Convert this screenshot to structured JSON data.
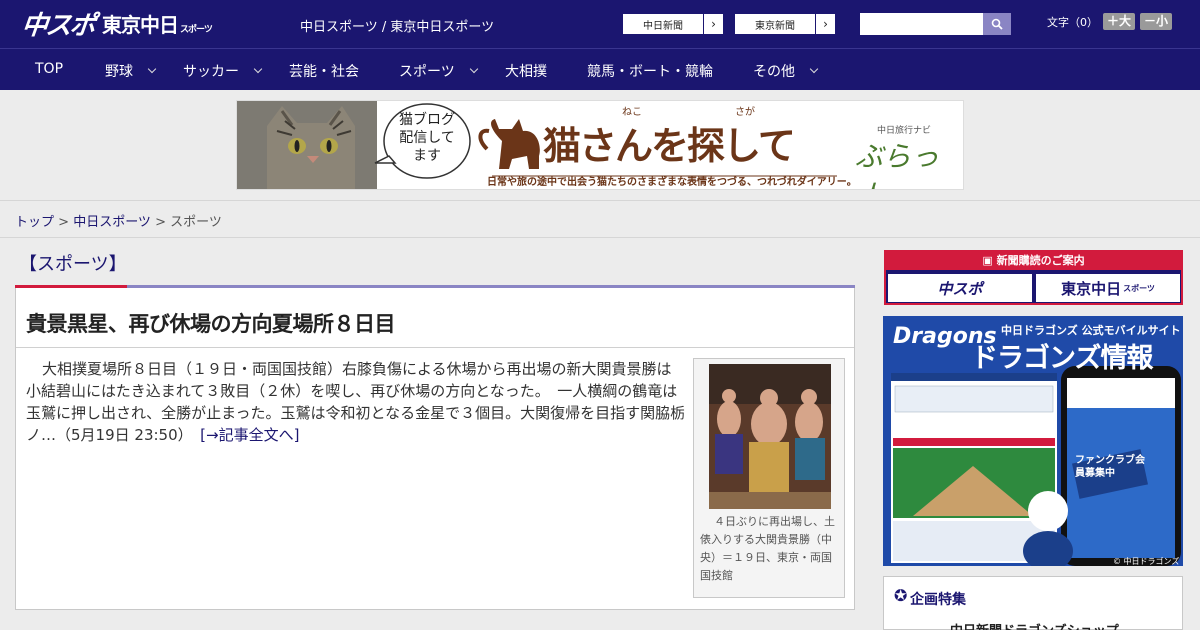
{
  "header": {
    "logo_main": "中スポ",
    "logo_sub": "東京中日",
    "logo_sub_small": "スポーツ",
    "site_links": "中日スポーツ / 東京中日スポーツ",
    "newspaper_links": [
      "中日新聞",
      "東京新聞"
    ],
    "search_placeholder": "",
    "font_size_label": "文字（0）",
    "font_plus": "＋大",
    "font_minus": "－小"
  },
  "nav": {
    "items": [
      {
        "label": "TOP",
        "has_menu": false
      },
      {
        "label": "野球",
        "has_menu": true
      },
      {
        "label": "サッカー",
        "has_menu": true
      },
      {
        "label": "芸能・社会",
        "has_menu": false
      },
      {
        "label": "スポーツ",
        "has_menu": true
      },
      {
        "label": "大相撲",
        "has_menu": false
      },
      {
        "label": "競馬・ボート・競輪",
        "has_menu": false
      },
      {
        "label": "その他",
        "has_menu": true
      }
    ]
  },
  "ad": {
    "bubble": "猫ブログ配信してます",
    "title": "猫さんを探して",
    "ruby_neko": "ねこ",
    "ruby_sagashi": "さが",
    "brand_small": "中日旅行ナビ",
    "brand": "ぶらっ人",
    "tagline": "日常や旅の途中で出会う猫たちのさまざまな表情をつづる、つれづれダイアリー。"
  },
  "breadcrumb": {
    "home": "トップ",
    "sep": " > ",
    "section": "中日スポーツ",
    "current": "スポーツ"
  },
  "category": "【スポーツ】",
  "article": {
    "headline": "貴景黒星、再び休場の方向夏場所８日目",
    "body": "大相撲夏場所８日目（１９日・両国国技館）右膝負傷による休場から再出場の新大関貴景勝は小結碧山にはたき込まれて３敗目（２休）を喫し、再び休場の方向となった。　一人横綱の鶴竜は玉鷲に押し出され、全勝が止まった。玉鷲は令和初となる金星で３個目。大関復帰を目指す関脇栃ノ…（5月19日 23:50）",
    "more_link": "[→記事全文へ]",
    "photo_caption": "４日ぶりに再出場し、土俵入りする大関貴景勝（中央）＝１９日、東京・両国国技館"
  },
  "sidebar": {
    "subscribe_header": "新聞購読のご案内",
    "subscribe_buttons": [
      "中スポ",
      "東京中日"
    ],
    "subscribe_small": "スポーツ",
    "dragons": {
      "logo": "Dragons",
      "top_text": "中日ドラゴンズ 公式モバイルサイト",
      "big_text": "ドラゴンズ情報",
      "badge": "ファンクラブ会員募集中",
      "footer": "© 中日ドラゴンズ"
    },
    "feature_title": "企画特集",
    "feature_item": "中日新聞ドラゴンズショップ"
  },
  "colors": {
    "brand": "#1b1670",
    "accent": "#d21b3d",
    "nav_bg": "#1b1670"
  }
}
